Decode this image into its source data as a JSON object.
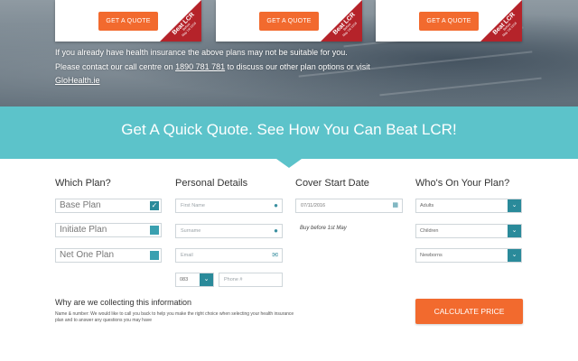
{
  "hero": {
    "quote_button_label": "GET A QUOTE",
    "ribbon_big": "Beat LCR",
    "ribbon_small_1": "Before",
    "ribbon_small_2": "May 1st 2016",
    "notice_line1": "If you already have health insurance the above plans may not be suitable for you.",
    "notice_line2_pre": "Please contact our call centre on ",
    "notice_phone": "1890 781 781",
    "notice_line2_post": " to discuss our other plan options or visit",
    "notice_link": "GloHealth.ie"
  },
  "band": {
    "heading": "Get A Quick Quote. See How You Can Beat LCR!"
  },
  "form": {
    "which_plan": {
      "title": "Which Plan?",
      "options": [
        "Base Plan",
        "Initiate Plan",
        "Net One Plan"
      ]
    },
    "personal": {
      "title": "Personal Details",
      "first_name_placeholder": "First Name",
      "surname_placeholder": "Surname",
      "email_placeholder": "Email",
      "phone_code": "083",
      "phone_placeholder": "Phone #"
    },
    "cover": {
      "title": "Cover Start Date",
      "date_value": "07/11/2016",
      "note": "Buy before 1st May"
    },
    "whos_on": {
      "title": "Who's On Your Plan?",
      "selects": [
        "Adults",
        "Children",
        "Newborns"
      ]
    },
    "why_title": "Why are we collecting this information",
    "why_body": "Name & number: We would like to call you back to help you make the right choice when selecting your health insurance plan and to answer any questions you may have",
    "calculate_label": "CALCULATE PRICE"
  },
  "colors": {
    "accent_orange": "#f26a2e",
    "teal_band": "#5cc3ca",
    "teal_control": "#2a8a9a",
    "ribbon_red": "#b5232a"
  }
}
